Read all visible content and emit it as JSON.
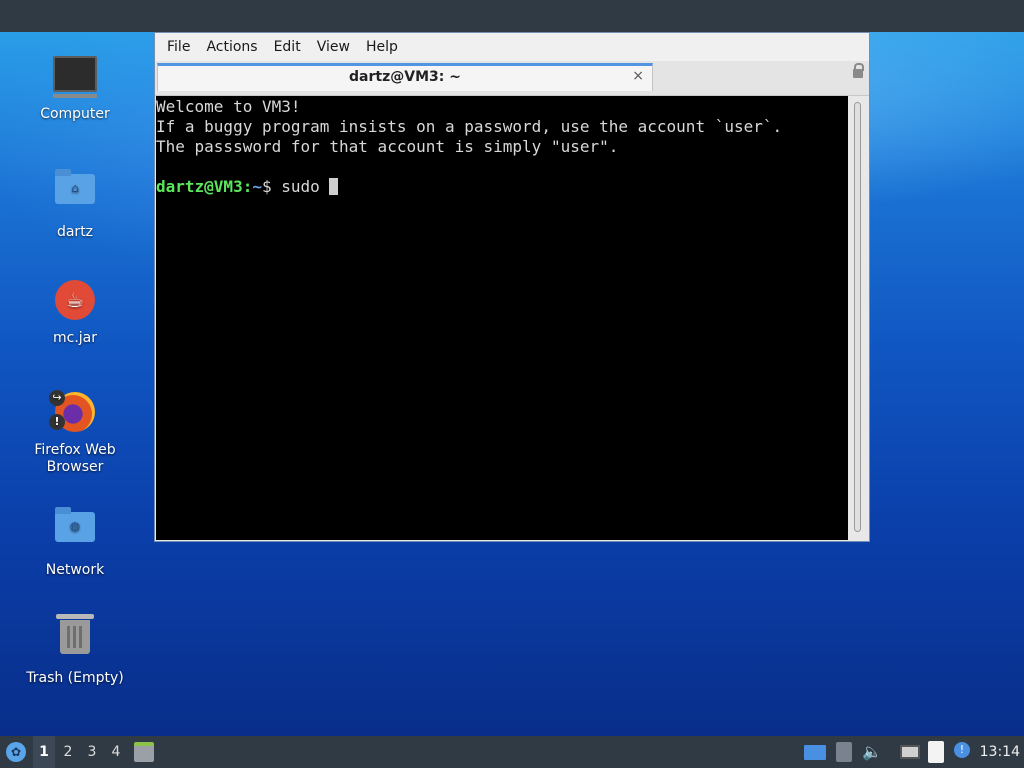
{
  "desktop": {
    "icons": [
      {
        "label": "Computer",
        "icon": "computer-icon"
      },
      {
        "label": "dartz",
        "icon": "home-folder-icon"
      },
      {
        "label": "mc.jar",
        "icon": "java-icon"
      },
      {
        "label": "Firefox Web Browser",
        "icon": "firefox-icon"
      },
      {
        "label": "Network",
        "icon": "network-folder-icon"
      },
      {
        "label": "Trash (Empty)",
        "icon": "trash-icon"
      }
    ]
  },
  "terminal": {
    "menu": [
      "File",
      "Actions",
      "Edit",
      "View",
      "Help"
    ],
    "tab_title": "dartz@VM3: ~",
    "tab_close": "×",
    "lines": [
      "Welcome to VM3!",
      "If a buggy program insists on a password, use the account `user`.",
      "The passsword for that account is simply \"user\".",
      ""
    ],
    "prompt_user": "dartz@VM3:",
    "prompt_path": "~",
    "prompt_symbol": "$ ",
    "command": "sudo "
  },
  "taskbar": {
    "workspaces": [
      "1",
      "2",
      "3",
      "4"
    ],
    "active_workspace": "1",
    "clock": "13:14"
  },
  "colors": {
    "panel": "#303a45",
    "terminal_bg": "#000000",
    "prompt_user": "#5ce65c",
    "prompt_path": "#6aa0e8",
    "tab_accent": "#5294e2"
  }
}
